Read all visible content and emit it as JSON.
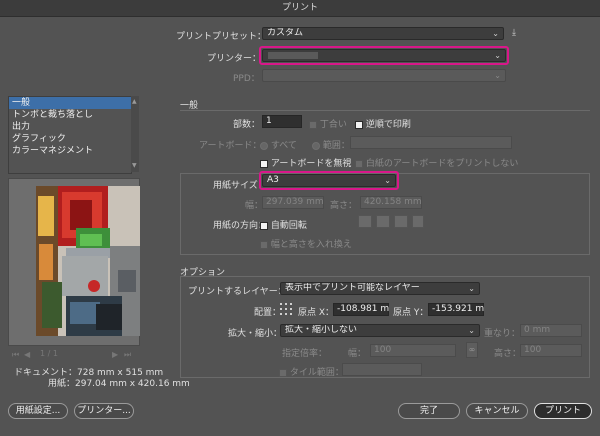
{
  "window": {
    "title": "プリント"
  },
  "top": {
    "preset_label": "プリントプリセット：",
    "preset_value": "カスタム",
    "printer_label": "プリンター：",
    "printer_value": "",
    "ppd_label": "PPD："
  },
  "sidebar": {
    "items": [
      {
        "label": "一般"
      },
      {
        "label": "トンボと裁ち落とし"
      },
      {
        "label": "出力"
      },
      {
        "label": "グラフィック"
      },
      {
        "label": "カラーマネジメント"
      }
    ],
    "nav_page": "1 / 1",
    "doc_label": "ドキュメント：728 mm x 515 mm",
    "paper_label": "用紙：297.04 mm x 420.16 mm"
  },
  "general": {
    "section_title": "一般",
    "copies_label": "部数：",
    "copies_value": "1",
    "collate_label": "丁合い",
    "reverse_label": "逆順で印刷",
    "artboard_label": "アートボード：",
    "all_label": "すべて",
    "range_label": "範囲：",
    "ignore_artboards_label": "アートボードを無視",
    "skip_blank_label": "白紙のアートボードをプリントしない",
    "paper_size_label": "用紙サイズ：",
    "paper_size_value": "A3",
    "width_label": "幅：",
    "width_value": "297.039 mm",
    "height_label": "高さ：",
    "height_value": "420.158 mm",
    "orientation_label": "用紙の方向：",
    "auto_rotate_label": "自動回転",
    "transverse_label": "幅と高さを入れ換え"
  },
  "options": {
    "section_title": "オプション",
    "layers_label": "プリントするレイヤー：",
    "layers_value": "表示中でプリント可能なレイヤー",
    "placement_label": "配置：",
    "origin_x_label": "原点 X：",
    "origin_x_value": "-108.981 m",
    "origin_y_label": "原点 Y：",
    "origin_y_value": "-153.921 m",
    "scale_label": "拡大・縮小：",
    "scale_value": "拡大・縮小しない",
    "overlap_label": "重なり：",
    "overlap_value": "0 mm",
    "scale_factor_label": "指定倍率：",
    "sf_width_label": "幅：",
    "sf_width_value": "100",
    "sf_height_label": "高さ：",
    "sf_height_value": "100",
    "tile_label": "タイル範囲："
  },
  "buttons": {
    "page_setup": "用紙設定...",
    "printer": "プリンター...",
    "done": "完了",
    "cancel": "キャンセル",
    "print": "プリント"
  },
  "colors": {
    "highlight": "#d9178a",
    "selection": "#3d6fa8"
  }
}
